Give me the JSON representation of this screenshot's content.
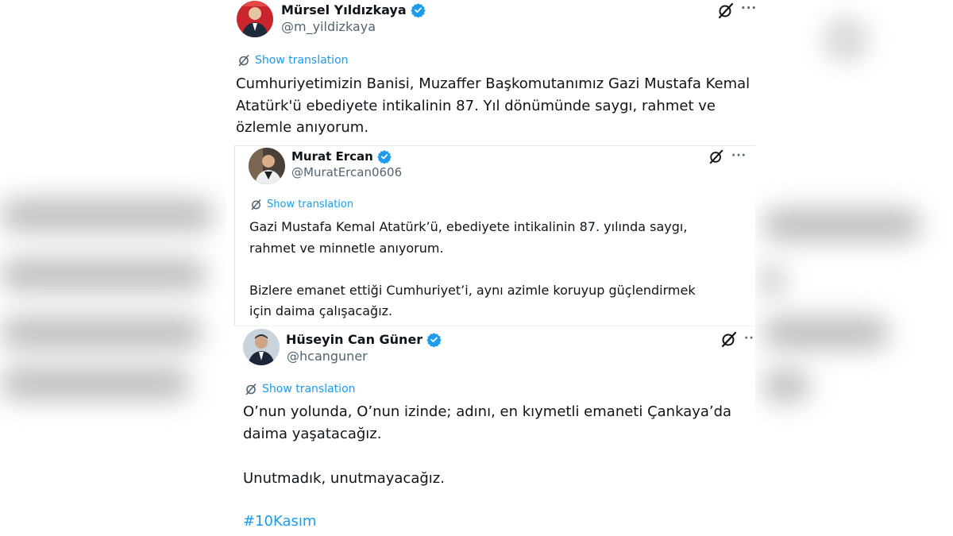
{
  "translate_label": "Show translation",
  "icons": {
    "verified": "verified-badge-icon",
    "grok": "grok-icon",
    "more": "more-options-icon",
    "translate": "translate-icon"
  },
  "colors": {
    "link": "#1d9bf0",
    "text": "#0f1419",
    "muted": "#536471",
    "verified": "#1d9bf0"
  },
  "tweets": [
    {
      "name": "Mürsel Yıldızkaya",
      "handle": "@m_yildizkaya",
      "text": "Cumhuriyetimizin Banisi, Muzaffer Başkomutanımız Gazi Mustafa Kemal\nAtatürk'ü ebediyete intikalinin 87. Yıl dönümünde saygı, rahmet ve\nözlemle anıyorum."
    },
    {
      "name": "Murat Ercan",
      "handle": "@MuratErcan0606",
      "text": "Gazi Mustafa Kemal Atatürk’ü, ebediyete intikalinin 87. yılında saygı,\nrahmet ve minnetle anıyorum.\n\nBizlere emanet ettiği Cumhuriyet’i, aynı azimle koruyup güçlendirmek\niçin daima çalışacağız."
    },
    {
      "name": "Hüseyin Can Güner",
      "handle": "@hcanguner",
      "text": "O’nun yolunda, O’nun izinde; adını, en kıymetli emaneti Çankaya’da\ndaima yaşatacağız.\n\nUnutmadık, unutmayacağız.",
      "hashtag": "#10Kasım"
    }
  ]
}
